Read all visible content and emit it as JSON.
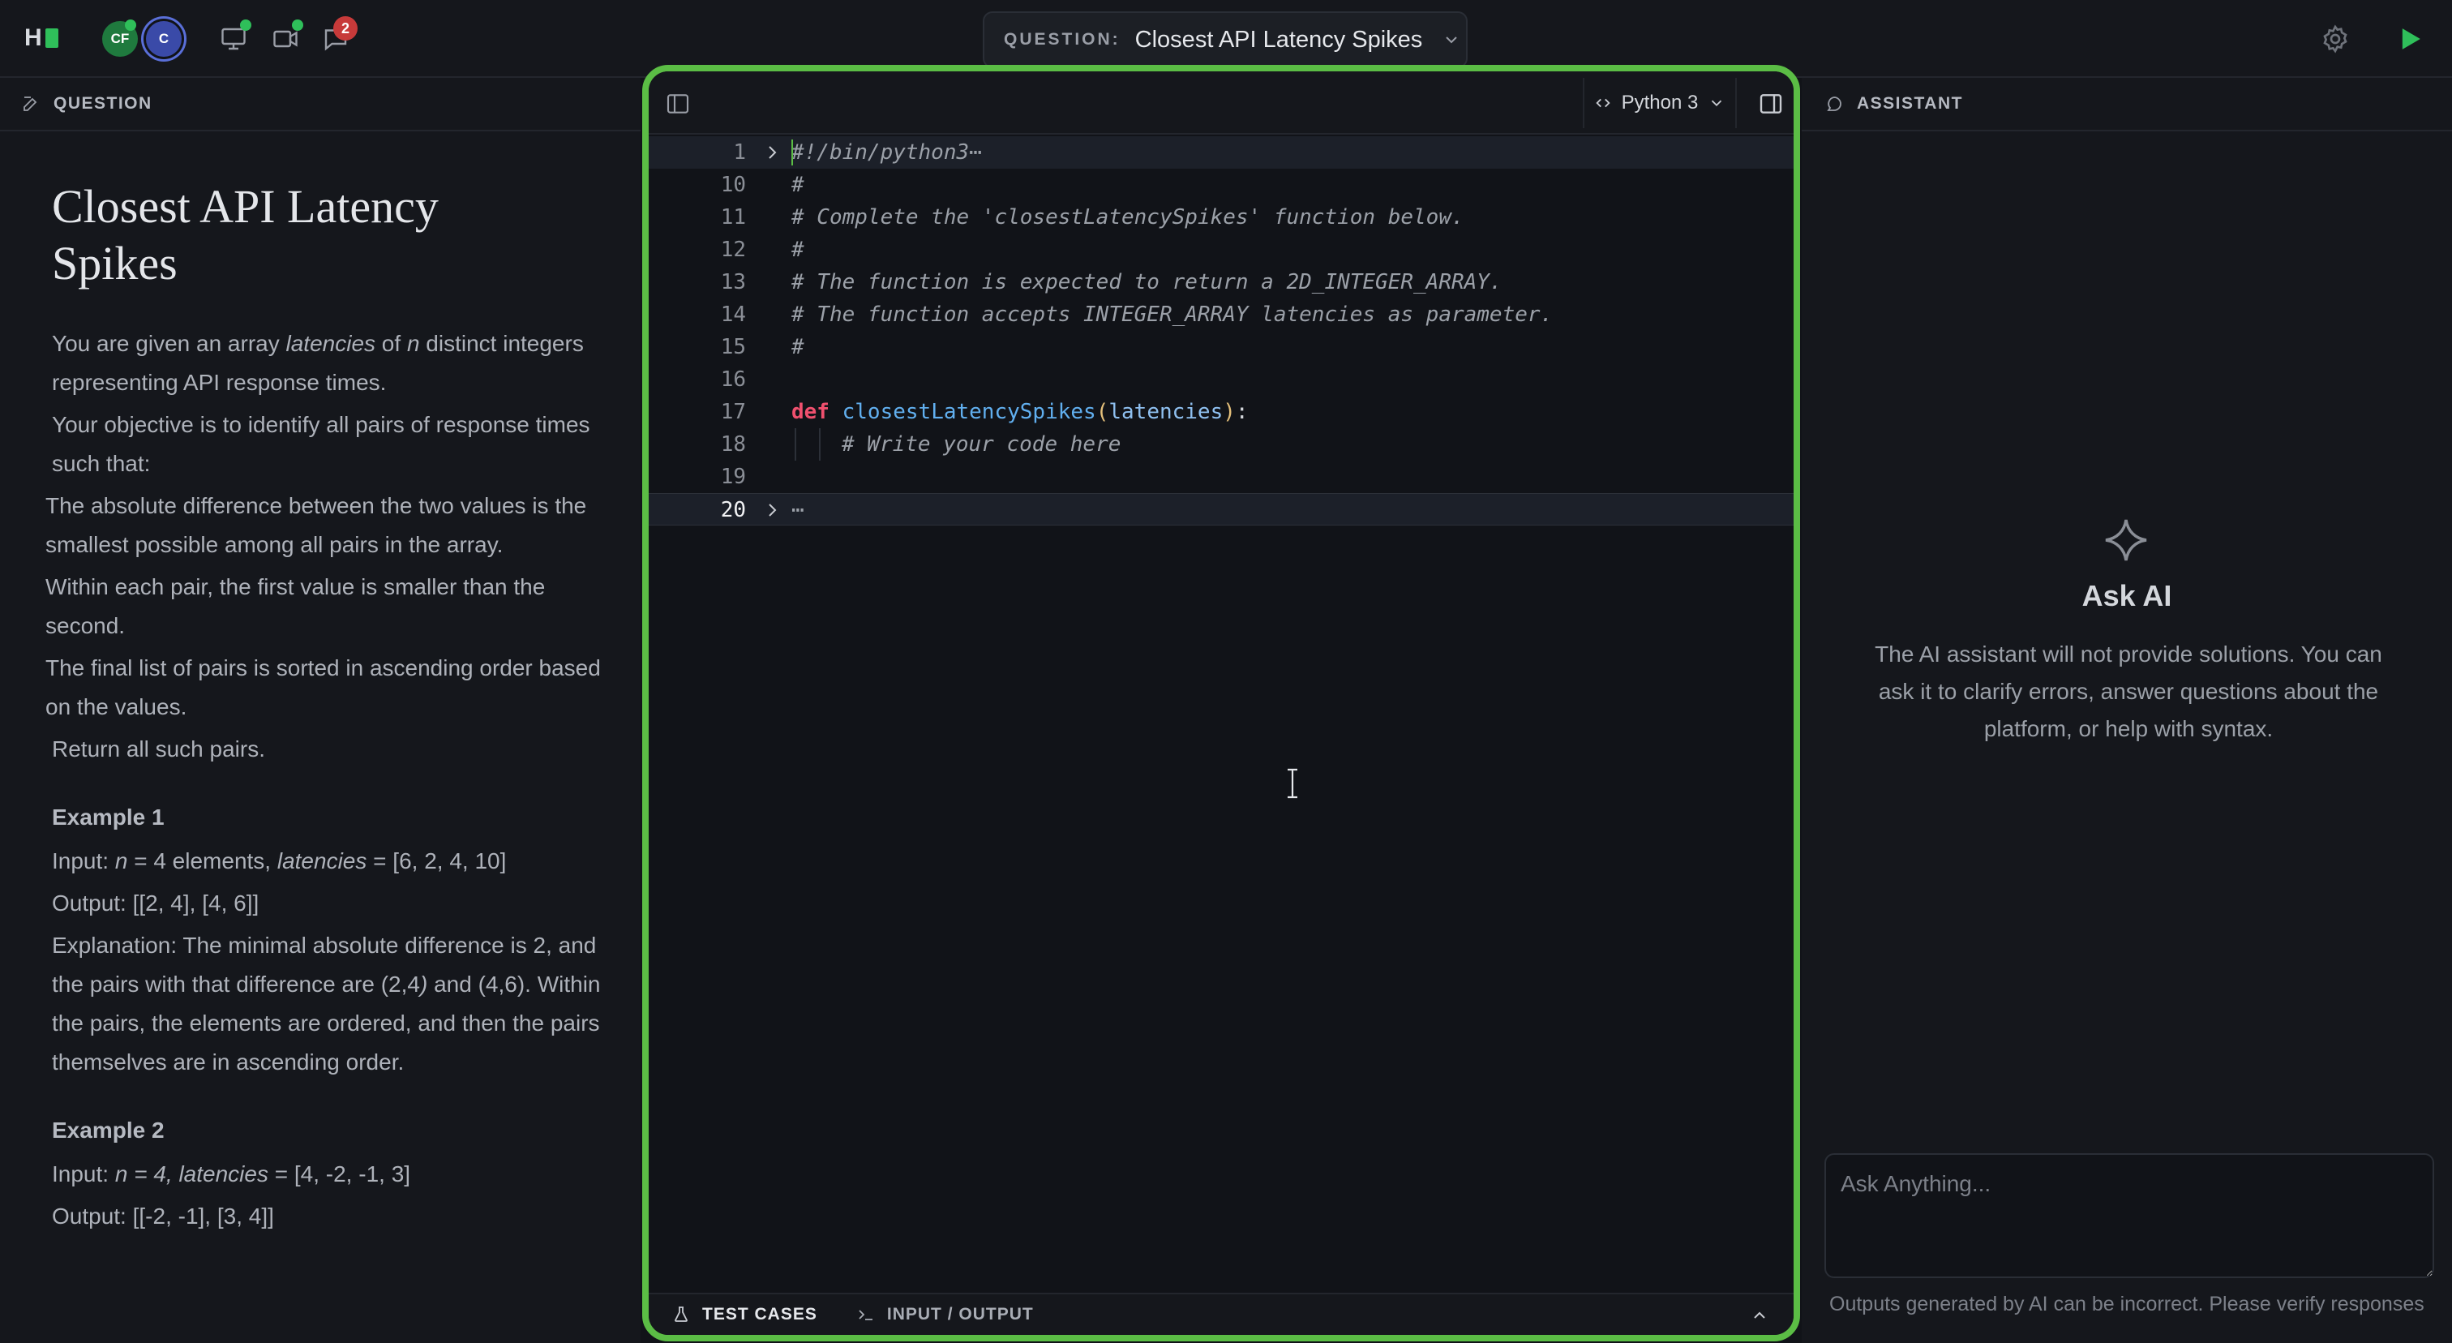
{
  "topbar": {
    "avatars": [
      "CF",
      "C"
    ],
    "chat_badge_count": "2",
    "question_label": "QUESTION:",
    "question_title": "Closest API Latency Spikes"
  },
  "question_panel": {
    "header": "QUESTION",
    "title": "Closest API Latency Spikes",
    "paragraphs": {
      "p1_a": "You are given an array ",
      "p1_em1": "latencies",
      "p1_b": " of ",
      "p1_em2": "n",
      "p1_c": " distinct integers representing API response times.",
      "p2": "Your objective is to identify all pairs of response times such that:",
      "p3": "The absolute difference between the two values is the smallest possible among all pairs in the array.",
      "p4": "Within each pair, the first value is smaller than the second.",
      "p5": "The final list of pairs is sorted in ascending order based on the values.",
      "p6": "Return all such pairs."
    },
    "example1": {
      "heading": "Example 1",
      "input_a": "Input: ",
      "input_em_n": "n",
      "input_b": " = 4 elements, ",
      "input_em_lat": "latencies",
      "input_c": " = [6, 2, 4, 10]",
      "output": "Output: [[2, 4], [4, 6]]",
      "explanation_a": "Explanation: The minimal absolute difference is 2, and the pairs with that difference are (2,4",
      "explanation_em": ")",
      "explanation_b": " and (4,6). Within the pairs, the elements are ordered, and then the pairs themselves are in ascending order."
    },
    "example2": {
      "heading": "Example 2",
      "input_a": "Input: ",
      "input_em": "n = 4, latencies",
      "input_b": " = [4, -2, -1, 3]",
      "output": "Output: [[-2, -1], [3, 4]]"
    }
  },
  "editor": {
    "language": "Python 3",
    "lines": [
      {
        "num": "1",
        "text": "#!/bin/python3",
        "ellipsis": "⋯"
      },
      {
        "num": "10",
        "text": "#"
      },
      {
        "num": "11",
        "text": "# Complete the 'closestLatencySpikes' function below."
      },
      {
        "num": "12",
        "text": "#"
      },
      {
        "num": "13",
        "text": "# The function is expected to return a 2D_INTEGER_ARRAY."
      },
      {
        "num": "14",
        "text": "# The function accepts INTEGER_ARRAY latencies as parameter."
      },
      {
        "num": "15",
        "text": "#"
      },
      {
        "num": "16",
        "text": ""
      },
      {
        "num": "17",
        "kw": "def",
        "fn": "closestLatencySpikes",
        "open": "(",
        "param": "latencies",
        "close": ")",
        "colon": ":"
      },
      {
        "num": "18",
        "text": "# Write your code here"
      },
      {
        "num": "19",
        "text": ""
      },
      {
        "num": "20",
        "ellipsis": "⋯"
      }
    ],
    "bottom_tabs": [
      "TEST CASES",
      "INPUT / OUTPUT"
    ]
  },
  "assistant": {
    "header": "ASSISTANT",
    "title": "Ask AI",
    "description": "The AI assistant will not provide solutions. You can ask it to clarify errors, answer questions about the platform, or help with syntax.",
    "input_placeholder": "Ask Anything...",
    "disclaimer": "Outputs generated by AI can be incorrect. Please verify responses"
  },
  "colors": {
    "accent_green": "#5bbd45",
    "keyword": "#f0506e",
    "function": "#61afef",
    "paren": "#e5c07b",
    "badge_red": "#c73a3a"
  },
  "icons": [
    "edit-icon",
    "monitor-icon",
    "video-icon",
    "chat-icon",
    "chevron-down-icon",
    "settings-icon",
    "run-icon",
    "sidebar-toggle-icon",
    "code-icon",
    "fold-arrow-icon",
    "flask-icon",
    "terminal-icon",
    "chevron-up-icon",
    "sparkle-icon",
    "text-cursor-icon"
  ]
}
